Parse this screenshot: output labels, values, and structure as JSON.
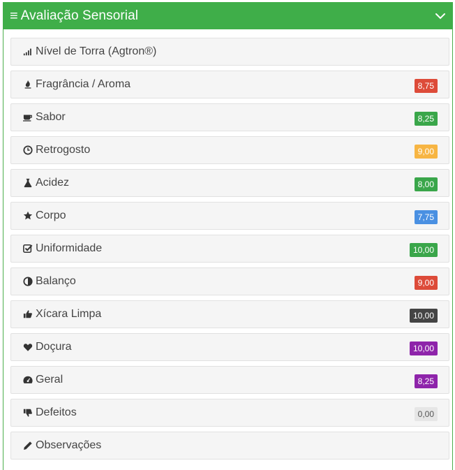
{
  "header": {
    "title": "Avaliação Sensorial"
  },
  "colors": {
    "header": "#3fae49",
    "red": "#dd4b39",
    "green": "#3aa64a",
    "orange": "#f7b543",
    "blue": "#4a90e2",
    "dark": "#444444",
    "purple": "#8e24aa",
    "light": "#e6e6e6"
  },
  "items": [
    {
      "label": "Nível de Torra (Agtron®)",
      "icon": "signal-icon",
      "badge": "",
      "badge_color": ""
    },
    {
      "label": "Fragrância / Aroma",
      "icon": "fire-icon",
      "badge": "8,75",
      "badge_color": "#dd4b39"
    },
    {
      "label": "Sabor",
      "icon": "coffee-cup-icon",
      "badge": "8,25",
      "badge_color": "#3aa64a"
    },
    {
      "label": "Retrogosto",
      "icon": "clock-icon",
      "badge": "9,00",
      "badge_color": "#f7b543"
    },
    {
      "label": "Acidez",
      "icon": "flask-icon",
      "badge": "8,00",
      "badge_color": "#3aa64a"
    },
    {
      "label": "Corpo",
      "icon": "star-icon",
      "badge": "7,75",
      "badge_color": "#4a90e2"
    },
    {
      "label": "Uniformidade",
      "icon": "checkbox-icon",
      "badge": "10,00",
      "badge_color": "#3aa64a"
    },
    {
      "label": "Balanço",
      "icon": "half-circle-icon",
      "badge": "9,00",
      "badge_color": "#dd4b39"
    },
    {
      "label": "Xícara Limpa",
      "icon": "thumbs-up-icon",
      "badge": "10,00",
      "badge_color": "#444444"
    },
    {
      "label": "Doçura",
      "icon": "heart-icon",
      "badge": "10,00",
      "badge_color": "#8e24aa"
    },
    {
      "label": "Geral",
      "icon": "dashboard-icon",
      "badge": "8,25",
      "badge_color": "#8e24aa"
    },
    {
      "label": "Defeitos",
      "icon": "thumbs-down-icon",
      "badge": "0,00",
      "badge_color": "#e6e6e6"
    },
    {
      "label": "Observações",
      "icon": "pencil-icon",
      "badge": "",
      "badge_color": ""
    }
  ]
}
